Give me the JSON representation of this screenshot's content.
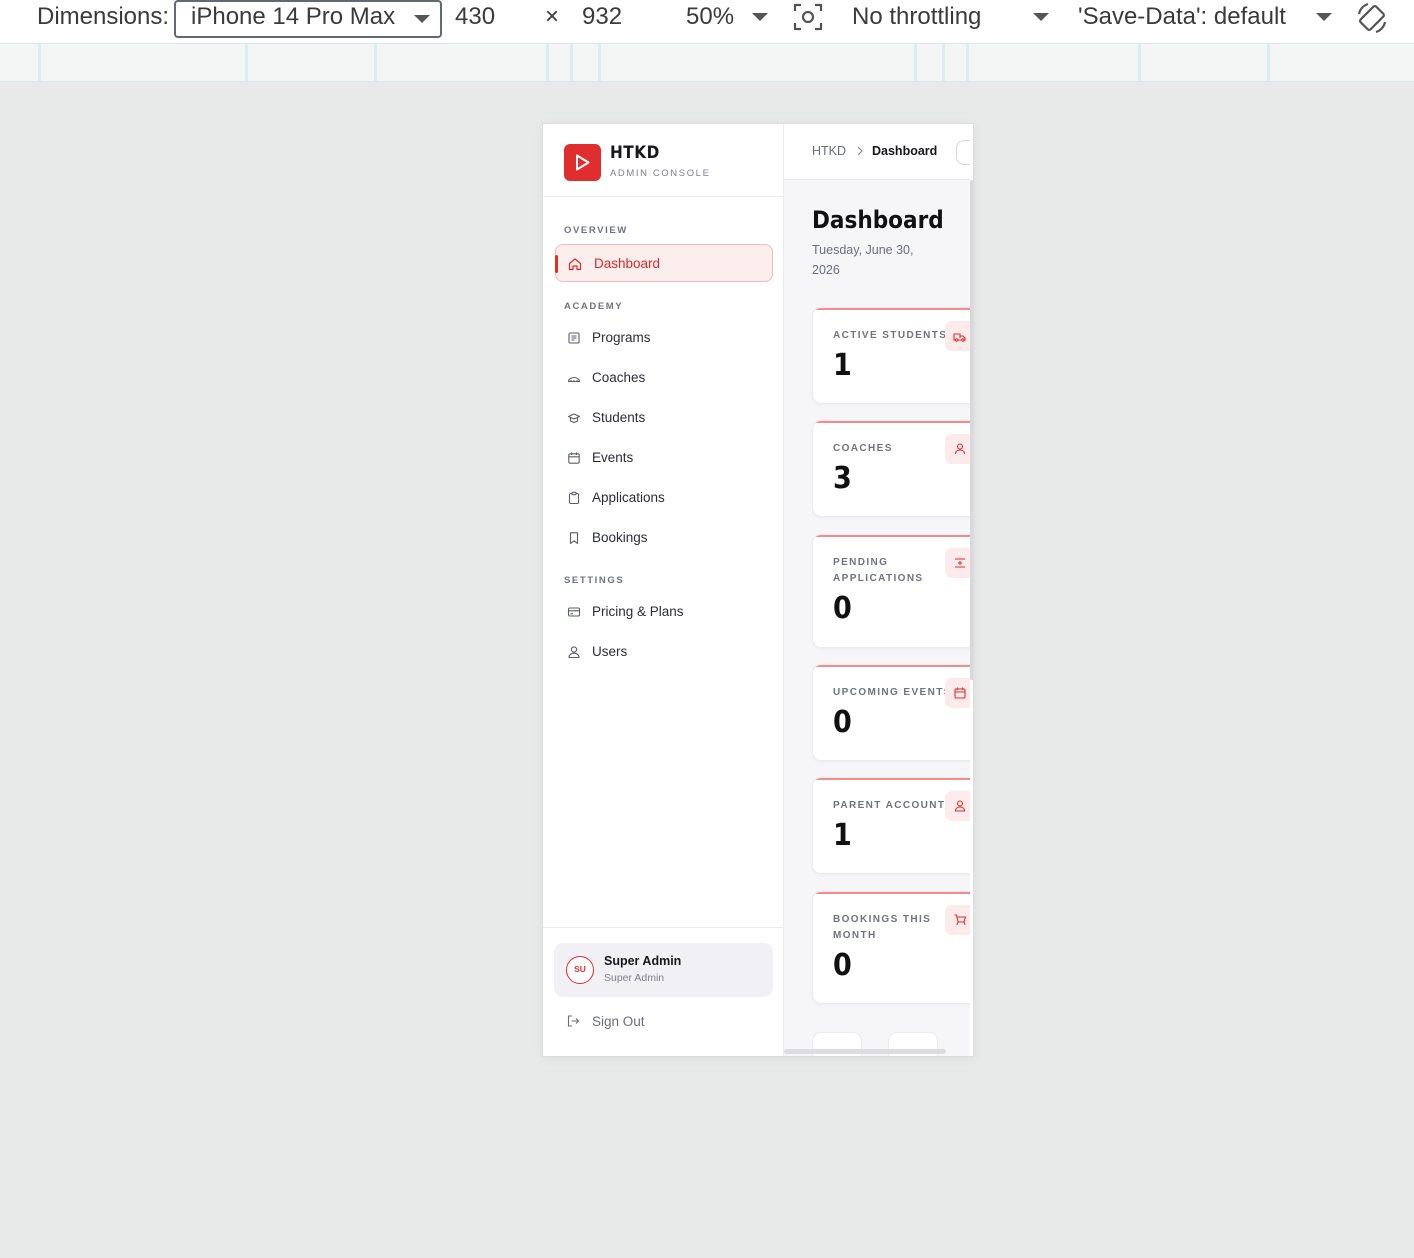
{
  "devtools": {
    "dimensions_label": "Dimensions:",
    "device": "iPhone 14 Pro Max",
    "width": "430",
    "times": "×",
    "height": "932",
    "zoom": "50%",
    "throttling": "No throttling",
    "save_data": "'Save-Data': default",
    "icons": [
      "chevron-down-icon",
      "screenshot-icon",
      "rotate-icon"
    ]
  },
  "brand": {
    "name": "HTKD",
    "subtitle": "ADMIN CONSOLE",
    "accent": "#e02d2d"
  },
  "sidebar": {
    "sections": [
      {
        "label": "OVERVIEW",
        "items": [
          {
            "label": "Dashboard",
            "icon": "home-icon",
            "active": true
          }
        ]
      },
      {
        "label": "ACADEMY",
        "items": [
          {
            "label": "Programs",
            "icon": "newspaper-icon"
          },
          {
            "label": "Coaches",
            "icon": "whistle-icon"
          },
          {
            "label": "Students",
            "icon": "graduation-cap-icon"
          },
          {
            "label": "Events",
            "icon": "calendar-icon"
          },
          {
            "label": "Applications",
            "icon": "clipboard-icon"
          },
          {
            "label": "Bookings",
            "icon": "bookmark-icon"
          }
        ]
      },
      {
        "label": "SETTINGS",
        "items": [
          {
            "label": "Pricing & Plans",
            "icon": "credit-card-icon"
          },
          {
            "label": "Users",
            "icon": "users-icon"
          }
        ]
      }
    ],
    "user": {
      "initials": "SU",
      "name": "Super Admin",
      "role": "Super Admin"
    },
    "sign_out": "Sign Out"
  },
  "breadcrumb": {
    "root": "HTKD",
    "current": "Dashboard"
  },
  "page": {
    "title": "Dashboard",
    "date": "Tuesday, June 30, 2026"
  },
  "stats": [
    {
      "label": "ACTIVE STUDENTS",
      "value": "1",
      "icon": "students-icon"
    },
    {
      "label": "COACHES",
      "value": "3",
      "icon": "user-icon"
    },
    {
      "label": "PENDING APPLICATIONS",
      "value": "0",
      "icon": "file-plus-icon"
    },
    {
      "label": "UPCOMING EVENTS",
      "value": "0",
      "icon": "calendar-icon"
    },
    {
      "label": "PARENT ACCOUNTS",
      "value": "1",
      "icon": "user-icon"
    },
    {
      "label": "BOOKINGS THIS MONTH",
      "value": "0",
      "icon": "cart-icon"
    }
  ]
}
